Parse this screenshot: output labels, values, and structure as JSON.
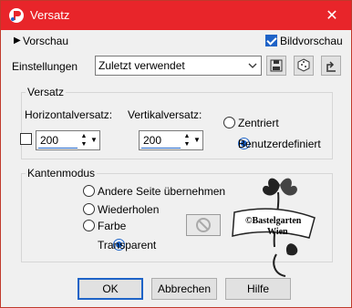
{
  "window": {
    "title": "Versatz",
    "close_glyph": "✕"
  },
  "top": {
    "preview_label": "Vorschau",
    "image_preview_label": "Bildvorschau",
    "image_preview_checked": true
  },
  "settings": {
    "label": "Einstellungen",
    "value": "Zuletzt verwendet"
  },
  "offset_group": {
    "title": "Versatz",
    "horizontal_label": "Horizontalversatz:",
    "horizontal_value": "200",
    "vertical_label": "Vertikalversatz:",
    "vertical_value": "200",
    "radio_centered": "Zentriert",
    "radio_user": "Benutzerdefiniert",
    "selected": "Benutzerdefiniert"
  },
  "edge_group": {
    "title": "Kantenmodus",
    "options": [
      "Andere Seite übernehmen",
      "Wiederholen",
      "Farbe",
      "Transparent"
    ],
    "selected": "Transparent"
  },
  "watermark": {
    "line1": "©Bastelgarten",
    "line2": "Wien"
  },
  "buttons": {
    "ok": "OK",
    "cancel": "Abbrechen",
    "help": "Hilfe"
  },
  "colors": {
    "titlebar": "#e8252a",
    "accent": "#1e63c7"
  }
}
